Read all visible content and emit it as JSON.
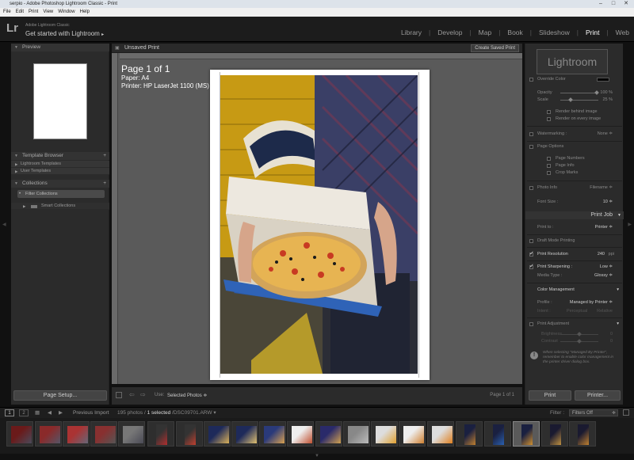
{
  "window": {
    "title": "serpio - Adobe Photoshop Lightroom Classic - Print",
    "controls": [
      "–",
      "□",
      "✕"
    ]
  },
  "menu": [
    "File",
    "Edit",
    "Print",
    "View",
    "Window",
    "Help"
  ],
  "identity": {
    "logo": "Lr",
    "product": "Adobe Lightroom Classic",
    "tagline": "Get started with Lightroom",
    "tagline_arrow": "▸"
  },
  "modules": {
    "items": [
      "Library",
      "Develop",
      "Map",
      "Book",
      "Slideshow",
      "Print",
      "Web"
    ],
    "active": "Print",
    "separator": "|"
  },
  "left_panel": {
    "preview_header": "Preview",
    "template_browser": "Template Browser",
    "templates": [
      "Lightroom Templates",
      "User Templates"
    ],
    "collections_header": "Collections",
    "filter_collections": "Filter Collections",
    "smart_collections": "Smart Collections",
    "plus": "+",
    "page_setup": "Page Setup..."
  },
  "center": {
    "title": "Unsaved Print",
    "create_saved": "Create Saved Print",
    "page_label": "Page 1 of 1",
    "paper": "Paper:  A4",
    "printer": "Printer:  HP LaserJet 1100 (MS)",
    "use_label": "Use:",
    "use_value": "Selected Photos",
    "use_arrow": "≑",
    "page_count": "Page 1 of 1"
  },
  "right_panel": {
    "identity_plate": "Lightroom",
    "override_color": "Override Color",
    "opacity_label": "Opacity",
    "opacity_value": "100 %",
    "opacity_level": 1.0,
    "scale_label": "Scale",
    "scale_value": "25 %",
    "scale_level": 0.25,
    "render_behind": "Render behind image",
    "render_every": "Render on every image",
    "watermarking": "Watermarking :",
    "watermarking_value": "None ≑",
    "page_options": "Page Options",
    "page_numbers": "Page Numbers",
    "page_info": "Page Info",
    "crop_marks": "Crop Marks",
    "photo_info": "Photo Info",
    "photo_info_value": "Filename ≑",
    "font_size": "Font Size :",
    "font_size_value": "10 ≑",
    "print_job_header": "Print Job",
    "print_to": "Print to :",
    "print_to_value": "Printer ≑",
    "draft_mode": "Draft Mode Printing",
    "print_resolution": "Print Resolution",
    "print_resolution_value": "240",
    "ppi": "ppi",
    "print_sharpening": "Print Sharpening :",
    "print_sharpening_value": "Low ≑",
    "media_type": "Media Type :",
    "media_type_value": "Glossy ≑",
    "color_management": "Color Management",
    "profile_label": "Profile :",
    "profile_value": "Managed by Printer ≑",
    "intent_label": "Intent :",
    "perceptual": "Perceptual",
    "relative": "Relative",
    "print_adjustment": "Print Adjustment",
    "brightness": "Brightness",
    "brightness_value": "0",
    "contrast": "Contrast",
    "contrast_value": "0",
    "note": "When selecting \"Managed By Printer\", remember to enable color management in the printer driver dialog box.",
    "print_button": "Print",
    "printer_button": "Printer...",
    "collapse_arrow": "▾",
    "info_icon": "!"
  },
  "filmstrip_nav": {
    "view1": "1",
    "view2": "2",
    "source": "Previous Import",
    "photos": "195 photos /",
    "selected": "1 selected",
    "filename": "/DSC09701.ARW",
    "filename_arrow": "▾",
    "filter_label": "Filter :",
    "filter_value": "Filters Off",
    "filter_arrow": "≑"
  },
  "filmstrip": {
    "thumbnail_count": 21,
    "selected_index": 18
  },
  "colors": {
    "accent_active": "#ffffff",
    "panel_bg": "#2b2b2b",
    "canvas_bg": "#5a5a5a"
  }
}
